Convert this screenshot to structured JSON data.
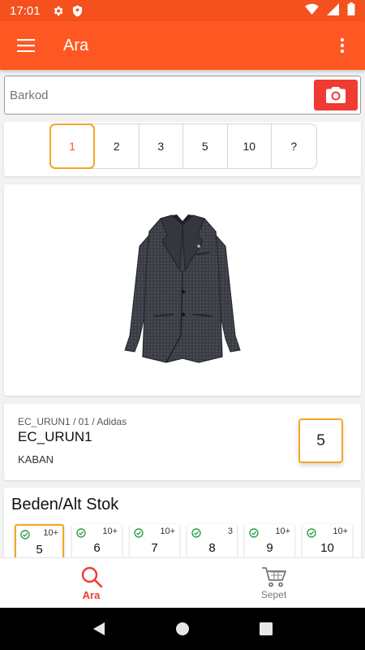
{
  "status_bar": {
    "time": "17:01"
  },
  "app_bar": {
    "title": "Ara"
  },
  "search": {
    "placeholder": "Barkod",
    "value": ""
  },
  "quantity_selector": {
    "options": [
      "1",
      "2",
      "3",
      "5",
      "10",
      "?"
    ],
    "selected": "1"
  },
  "product": {
    "subtitle": "EC_URUN1 / 01 / Adidas",
    "code": "EC_URUN1",
    "category": "KABAN",
    "quantity": "5"
  },
  "sizes": {
    "title": "Beden/Alt Stok",
    "items": [
      {
        "label": "5",
        "stock": "10+"
      },
      {
        "label": "6",
        "stock": "10+"
      },
      {
        "label": "7",
        "stock": "10+"
      },
      {
        "label": "8",
        "stock": "3"
      },
      {
        "label": "9",
        "stock": "10+"
      },
      {
        "label": "10",
        "stock": "10+"
      }
    ]
  },
  "bottom_nav": {
    "items": [
      {
        "label": "Ara",
        "icon": "search-icon",
        "active": true
      },
      {
        "label": "Sepet",
        "icon": "cart-icon",
        "active": false
      }
    ]
  },
  "colors": {
    "accent": "#ff5722",
    "camera": "#ef3b33",
    "highlight": "#f5a623",
    "in_stock": "#2e9e44"
  }
}
